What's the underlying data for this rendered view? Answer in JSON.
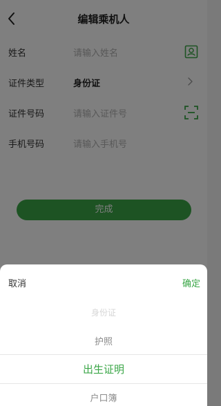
{
  "header": {
    "title": "编辑乘机人"
  },
  "form": {
    "name": {
      "label": "姓名",
      "placeholder": "请输入姓名"
    },
    "id_type": {
      "label": "证件类型",
      "value": "身份证"
    },
    "id_number": {
      "label": "证件号码",
      "placeholder": "请输入证件号"
    },
    "phone": {
      "label": "手机号码",
      "placeholder": "请输入手机号"
    }
  },
  "actions": {
    "done_label": "完成"
  },
  "picker": {
    "cancel_label": "取消",
    "confirm_label": "确定",
    "options": [
      "身份证",
      "护照",
      "出生证明",
      "户口簿"
    ],
    "selected": "出生证明"
  },
  "colors": {
    "accent": "#3aa647",
    "overlay": "rgba(0,0,0,0.5)"
  },
  "icons": {
    "back": "chevron-left-icon",
    "contact": "contact-card-icon",
    "chevron": "chevron-right-icon",
    "scan": "scan-frame-icon"
  }
}
